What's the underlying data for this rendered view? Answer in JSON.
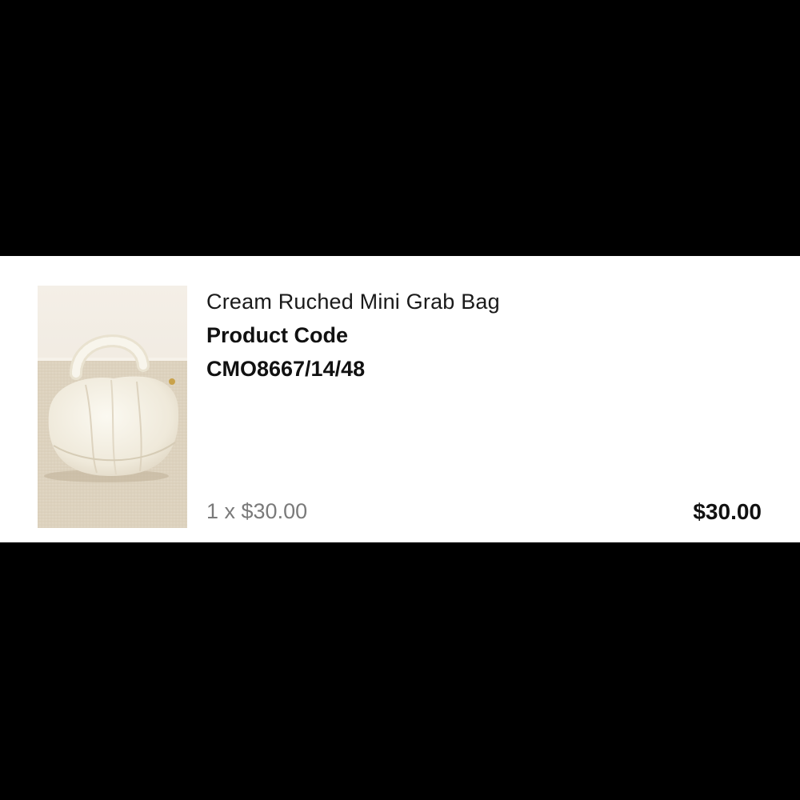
{
  "cart_item": {
    "image_alt": "Cream Ruched Mini Grab Bag",
    "name": "Cream Ruched Mini Grab Bag",
    "code_label": "Product Code",
    "code_value": "CMO8667/14/48",
    "quantity_line": "1 x $30.00",
    "line_total": "$30.00"
  },
  "colors": {
    "background": "#000000",
    "card": "#ffffff",
    "muted_text": "#7a7a7a",
    "text": "#111111"
  }
}
